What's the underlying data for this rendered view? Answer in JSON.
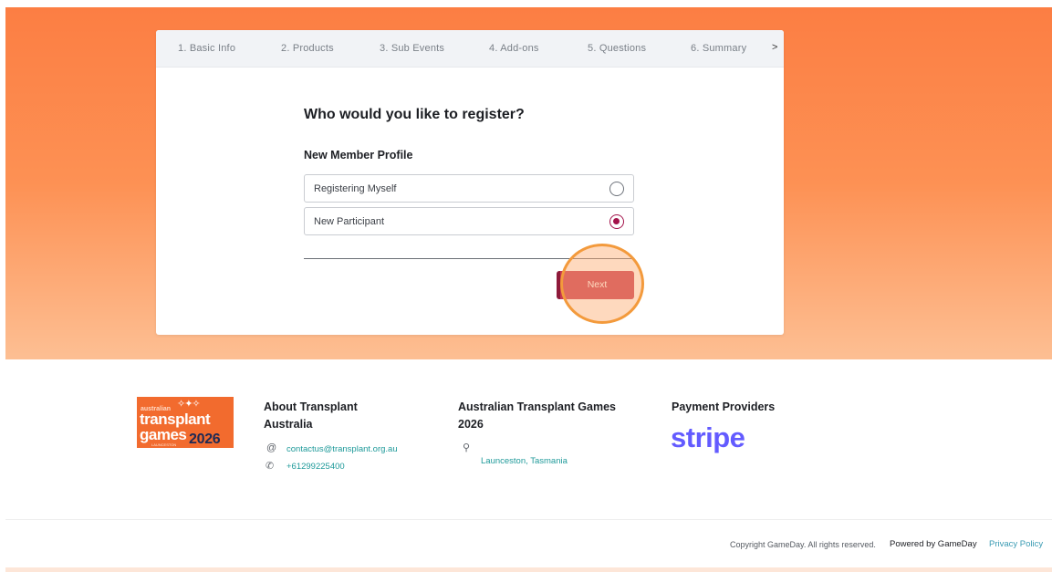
{
  "steps": {
    "items": [
      {
        "label": "1. Basic Info"
      },
      {
        "label": "2. Products"
      },
      {
        "label": "3. Sub Events"
      },
      {
        "label": "4. Add-ons"
      },
      {
        "label": "5. Questions"
      },
      {
        "label": "6. Summary"
      }
    ],
    "more_arrow": ">"
  },
  "form": {
    "question": "Who would you like to register?",
    "profile_label": "New Member Profile",
    "options": [
      {
        "label": "Registering Myself",
        "selected": false
      },
      {
        "label": "New Participant",
        "selected": true
      }
    ],
    "next_label": "Next"
  },
  "footer": {
    "logo": {
      "line1": "australian",
      "line2": "transplant",
      "line3": "games",
      "year": "2026",
      "city": "LAUNCESTON"
    },
    "about": {
      "heading": "About Transplant Australia",
      "email": "contactus@transplant.org.au",
      "phone": "+61299225400"
    },
    "games": {
      "heading": "Australian Transplant Games 2026",
      "location": "Launceston, Tasmania"
    },
    "payment": {
      "heading": "Payment Providers",
      "provider": "stripe"
    },
    "copyright": "Copyright GameDay. All rights reserved.",
    "powered_by": "Powered by GameDay",
    "privacy": "Privacy Policy"
  },
  "colors": {
    "hero_orange": "#fc7e43",
    "accent": "#a3124a",
    "button": "#c83a52",
    "link": "#1f9a9a",
    "stripe": "#635bff"
  }
}
